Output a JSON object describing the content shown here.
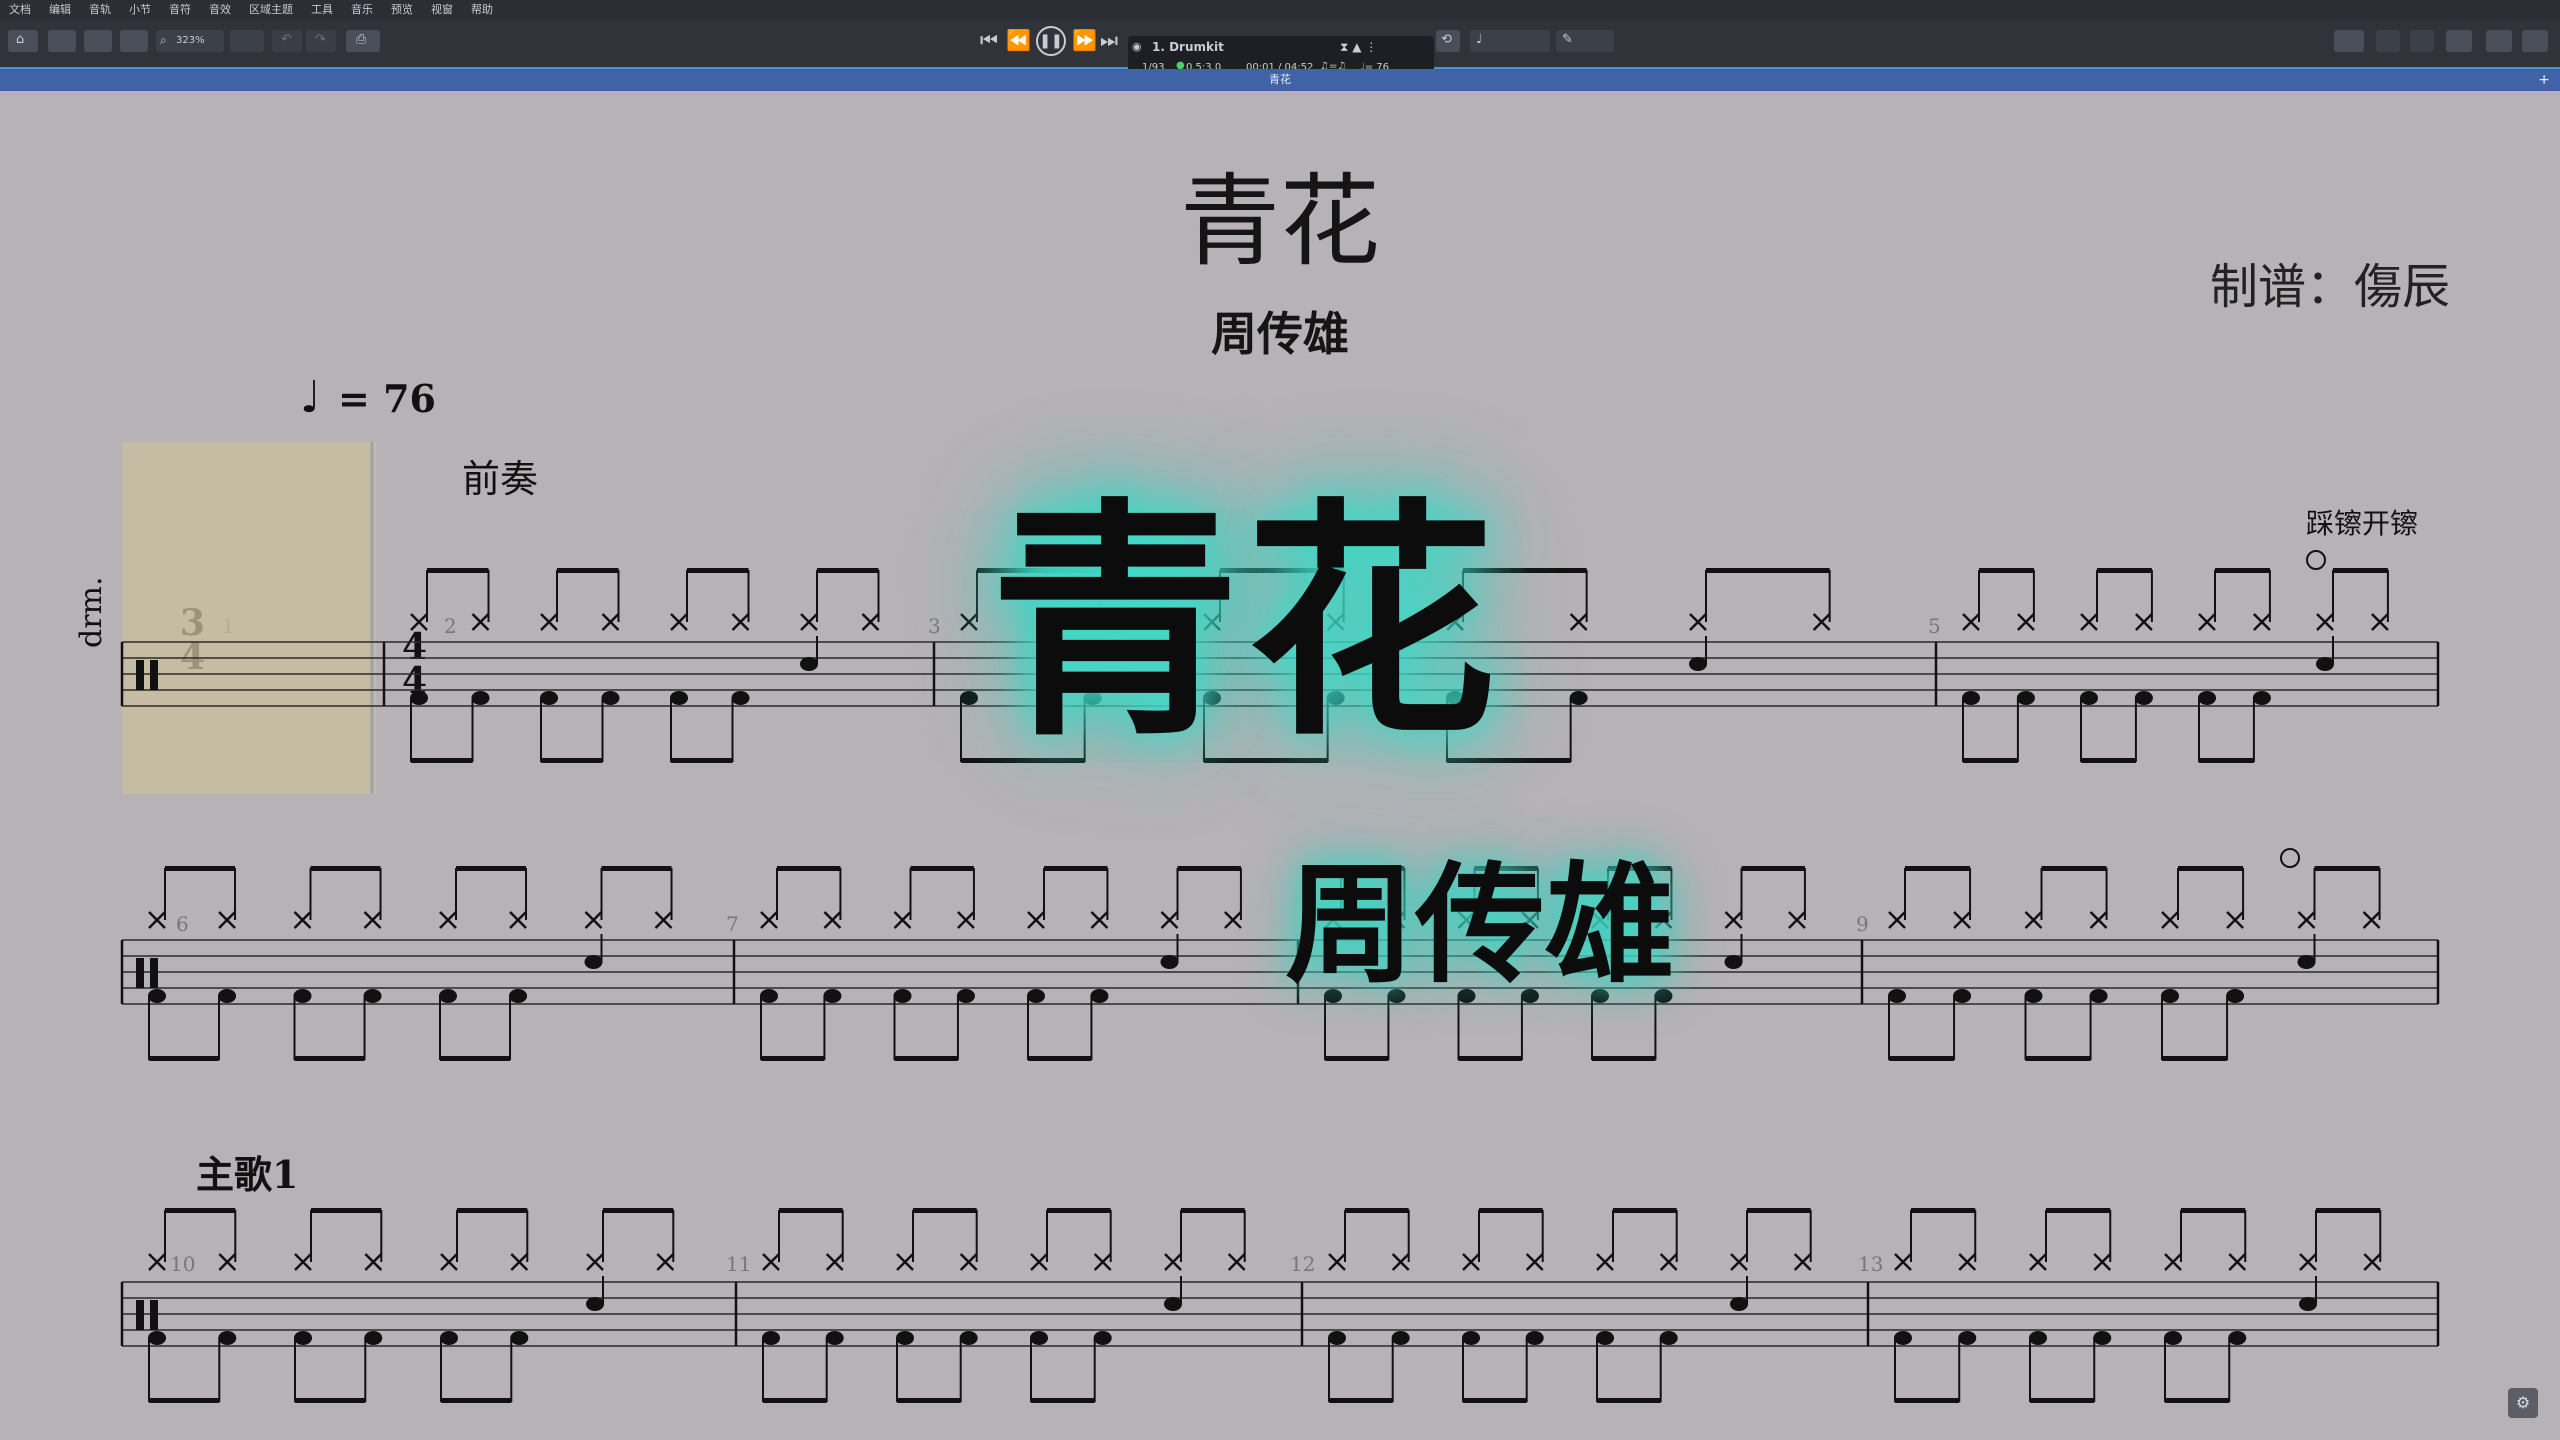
{
  "menu": [
    "文档",
    "编辑",
    "音轨",
    "小节",
    "音符",
    "音效",
    "区域主题",
    "工具",
    "音乐",
    "预览",
    "视窗",
    "帮助"
  ],
  "toolbar": {
    "zoom": "323%",
    "track_name": "1. Drumkit",
    "bar_position": "1/93",
    "beat_position": "0.5:3.0",
    "time": "00:01 / 04:52",
    "tempo_display": "♩= 76"
  },
  "tab": {
    "title": "青花"
  },
  "score": {
    "title": "青花",
    "composer": "周传雄",
    "transcriber": "制谱：傷辰",
    "tempo_mark": "= 76",
    "instrument": "drm.",
    "time_signature": {
      "numerator": "4",
      "old_numerator": "3",
      "denominator": "4"
    },
    "sections": {
      "intro": "前奏",
      "verse": "主歌1"
    },
    "hihat_open": "踩镲开镲",
    "bar_numbers": [
      "1",
      "2",
      "3",
      "5",
      "6",
      "7",
      "9",
      "10",
      "11",
      "12",
      "13"
    ]
  },
  "watermark": {
    "title": "青花",
    "artist": "周传雄"
  },
  "colors": {
    "background": "#b7b2b6",
    "highlight": "#cbbf9e",
    "glow": "#3fd9c6",
    "toolbar": "#30333a",
    "accent": "#4a8fe0"
  }
}
